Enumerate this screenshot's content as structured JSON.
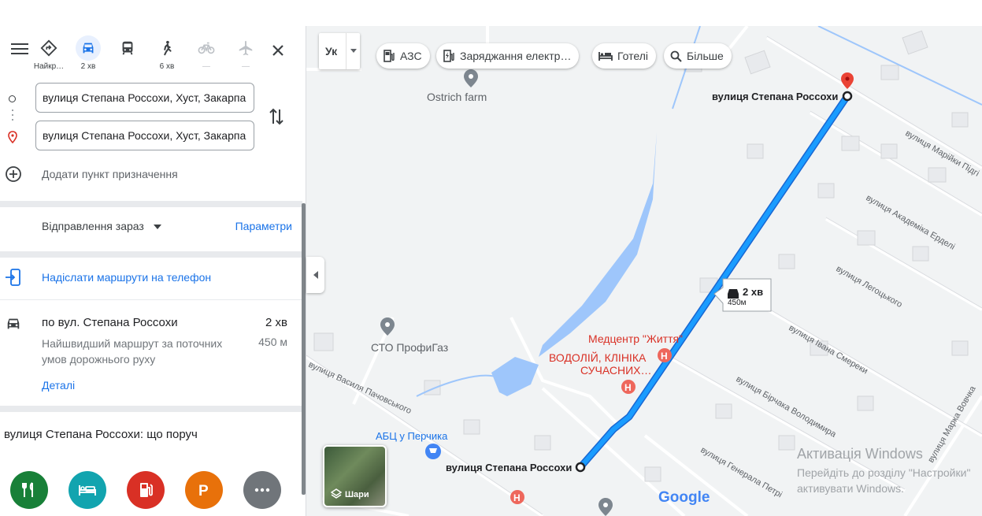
{
  "modes": [
    {
      "label": "Найкр…",
      "icon": "best-route-icon"
    },
    {
      "label": "2 хв",
      "icon": "car-icon"
    },
    {
      "label": "",
      "icon": "transit-icon"
    },
    {
      "label": "6 хв",
      "icon": "walk-icon"
    },
    {
      "label": "—",
      "icon": "bicycle-icon"
    },
    {
      "label": "—",
      "icon": "plane-icon"
    }
  ],
  "origin_value": "вулиця Степана Россохи, Хуст, Закарпа",
  "destination_value": "вулиця Степана Россохи, Хуст, Закарпа",
  "add_destination": "Додати пункт призначення",
  "depart_now": "Відправлення зараз",
  "parameters": "Параметри",
  "send_to_phone": "Надіслати маршрути на телефон",
  "route": {
    "title": "по вул. Степана Россохи",
    "time": "2 хв",
    "description": "Найшвидший маршрут за поточних умов дорожнього руху",
    "distance": "450 м",
    "details": "Деталі"
  },
  "nearby_title": "вулиця Степана Россохи: що поруч",
  "nearby_categories": [
    "restaurants",
    "hotels",
    "gas-stations",
    "parking",
    "more"
  ],
  "colors": {
    "restaurants": "#188038",
    "hotels": "#12a4af",
    "gas": "#d93025",
    "parking": "#e8710a",
    "more": "#70757a",
    "route": "#1a9cff",
    "accent": "#1a73e8"
  },
  "map": {
    "lang_chip": "Ук",
    "chips": [
      "АЗС",
      "Заряджання електр…",
      "Готелі",
      "Більше"
    ],
    "street_top": "вулиця Степана Россохи",
    "street_bottom": "вулиця Степана Россохи",
    "route_bubble_time": "2 хв",
    "route_bubble_dist": "450м",
    "places": {
      "ostrich": "Ostrich farm",
      "sto": "СТО ПрофиГаз",
      "medcenter": "Медцентр \"Життя\"",
      "vodoliy1": "ВОДОЛІЙ, КЛІНІКА",
      "vodoliy2": "СУЧАСНИХ…",
      "abc": "АБЦ у Перчика"
    },
    "streets": [
      "вулиця Марійки Підгі",
      "вулиця Академіка Ерделі",
      "вулиця Легоцького",
      "вулиця Івана Смереки",
      "вулиця Бірчака Володимира",
      "вулиця Генерала Петрі",
      "вулиця Марка Вовчка",
      "вулиця Василя Пачовського"
    ],
    "layers_label": "Шари",
    "google": "Google",
    "watermark_title": "Активація Windows",
    "watermark_line1": "Перейдіть до розділу \"Настройки\"",
    "watermark_line2": "активувати Windows."
  }
}
